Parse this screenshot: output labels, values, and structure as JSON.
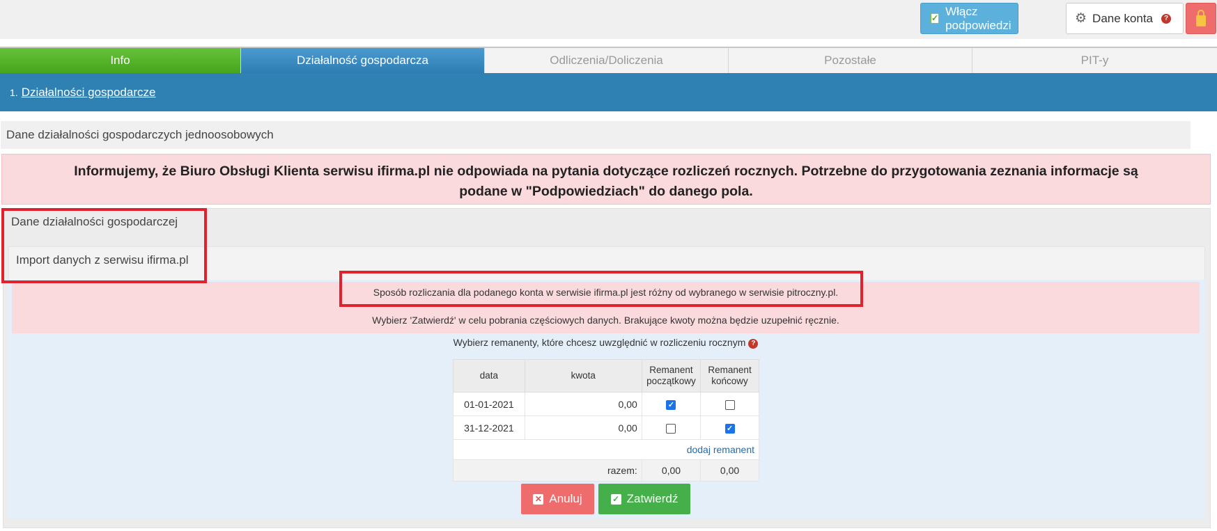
{
  "topbar": {
    "hints_label": "Włącz podpowiedzi",
    "account_label": "Dane konta",
    "help_glyph": "?"
  },
  "tabs": [
    {
      "label": "Info"
    },
    {
      "label": "Działalność gospodarcza"
    },
    {
      "label": "Odliczenia/Doliczenia"
    },
    {
      "label": "Pozostałe"
    },
    {
      "label": "PIT-y"
    }
  ],
  "subnav": {
    "number": "1.",
    "link": "Działalności gospodarcze"
  },
  "panel_title": "Dane działalności gospodarczych jednoosobowych",
  "alert": {
    "line1": "Informujemy, że Biuro Obsługi Klienta serwisu ifirma.pl nie odpowiada na pytania dotyczące rozliczeń rocznych. Potrzebne do przygotowania zeznania informacje są",
    "line2": "podane w \"Podpowiedziach\" do danego pola."
  },
  "section_title": "Dane działalności gospodarczej",
  "subsection_title": "Import danych z serwisu ifirma.pl",
  "warning": {
    "line1": "Sposób rozliczania dla podanego konta w serwisie ifirma.pl jest różny od wybranego w serwisie pitroczny.pl.",
    "line2": "Wybierz 'Zatwierdź' w celu pobrania częściowych danych. Brakujące kwoty można będzie uzupełnić ręcznie."
  },
  "choose_label": "Wybierz remanenty, które chcesz uwzględnić w rozliczeniu rocznym",
  "table": {
    "headers": {
      "date": "data",
      "amount": "kwota",
      "start_1": "Remanent",
      "start_2": "początkowy",
      "end_1": "Remanent",
      "end_2": "końcowy"
    },
    "rows": [
      {
        "date": "01-01-2021",
        "amount": "0,00",
        "start": true,
        "end": false
      },
      {
        "date": "31-12-2021",
        "amount": "0,00",
        "start": false,
        "end": true
      }
    ],
    "add_link": "dodaj remanent",
    "sum_label": "razem:",
    "sum_start": "0,00",
    "sum_end": "0,00"
  },
  "buttons": {
    "cancel": "Anuluj",
    "confirm": "Zatwierdź"
  }
}
